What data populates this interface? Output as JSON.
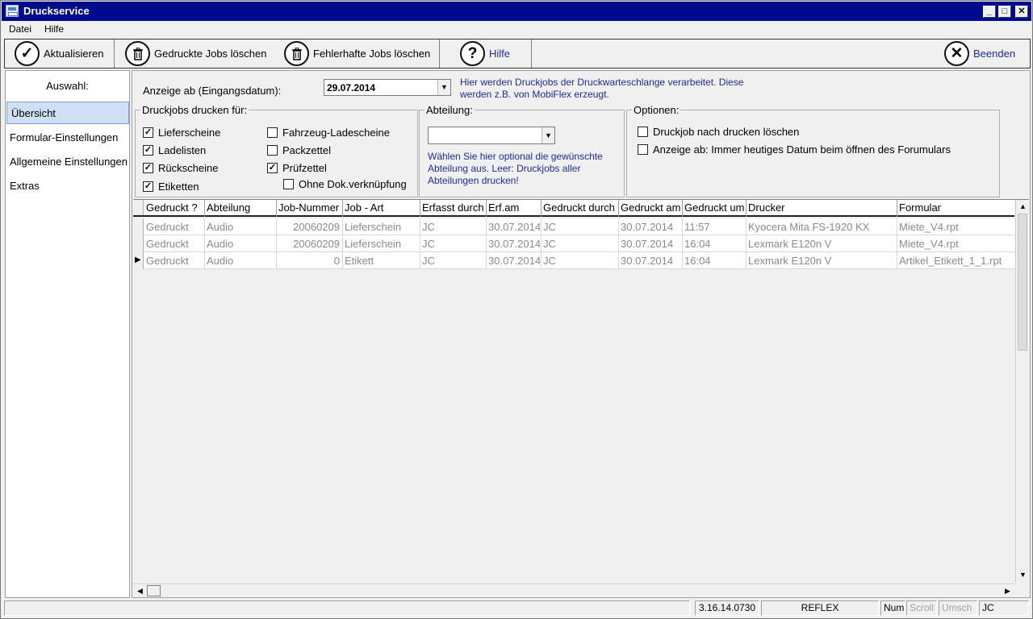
{
  "window": {
    "title": "Druckservice"
  },
  "menu": [
    "Datei",
    "Hilfe"
  ],
  "toolbar": {
    "refresh": "Aktualisieren",
    "delete_printed": "Gedruckte Jobs löschen",
    "delete_failed": "Fehlerhafte Jobs löschen",
    "help": "Hilfe",
    "exit": "Beenden"
  },
  "nav": {
    "header": "Auswahl:",
    "items": [
      "Übersicht",
      "Formular-Einstellungen",
      "Allgemeine Einstellungen",
      "Extras"
    ],
    "selected": "Übersicht"
  },
  "filter": {
    "date_label": "Anzeige ab (Eingangsdatum):",
    "date_value": "29.07.2014",
    "info_line1": "Hier werden Druckjobs der Druckwarteschlange verarbeitet. Diese",
    "info_line2": "werden z.B. von MobiFlex erzeugt."
  },
  "print_for": {
    "title": "Druckjobs drucken für:",
    "options": [
      {
        "label": "Lieferscheine",
        "checked": true
      },
      {
        "label": "Ladelisten",
        "checked": true
      },
      {
        "label": "Rückscheine",
        "checked": true
      },
      {
        "label": "Etiketten",
        "checked": true
      },
      {
        "label": "Fahrzeug-Ladescheine",
        "checked": false
      },
      {
        "label": "Packzettel",
        "checked": false
      },
      {
        "label": "Prüfzettel",
        "checked": true
      },
      {
        "label": "Ohne Dok.verknüpfung",
        "checked": false
      }
    ]
  },
  "department": {
    "title": "Abteilung:",
    "value": "",
    "hint_line1": "Wählen Sie hier optional die gewünschte",
    "hint_line2": "Abteilung aus. Leer: Druckjobs aller",
    "hint_line3": "Abteilungen drucken!"
  },
  "options": {
    "title": "Optionen:",
    "items": [
      {
        "label": "Druckjob nach drucken löschen",
        "checked": false
      },
      {
        "label": "Anzeige ab: Immer heutiges Datum beim öffnen des Forumulars",
        "checked": false
      }
    ]
  },
  "grid": {
    "columns": [
      "Gedruckt ?",
      "Abteilung",
      "Job-Nummer",
      "Job - Art",
      "Erfasst durch",
      "Erf.am",
      "Gedruckt durch",
      "Gedruckt am",
      "Gedruckt um",
      "Drucker",
      "Formular"
    ],
    "rows": [
      [
        "Gedruckt",
        "Audio",
        "20060209",
        "Lieferschein",
        "JC",
        "30.07.2014",
        "JC",
        "30.07.2014",
        "11:57",
        "Kyocera Mita FS-1920 KX",
        "Miete_V4.rpt"
      ],
      [
        "Gedruckt",
        "Audio",
        "20060209",
        "Lieferschein",
        "JC",
        "30.07.2014",
        "JC",
        "30.07.2014",
        "16:04",
        "Lexmark E120n V",
        "Miete_V4.rpt"
      ],
      [
        "Gedruckt",
        "Audio",
        "0",
        "Etikett",
        "JC",
        "30.07.2014",
        "JC",
        "30.07.2014",
        "16:04",
        "Lexmark E120n V",
        "Artikel_Etikett_1_1.rpt"
      ]
    ],
    "current_row": 3
  },
  "statusbar": {
    "version": "3.16.14.0730",
    "db": "REFLEX",
    "num": "Num",
    "scroll": "Scroll",
    "caps": "Umsch",
    "user": "JC"
  }
}
